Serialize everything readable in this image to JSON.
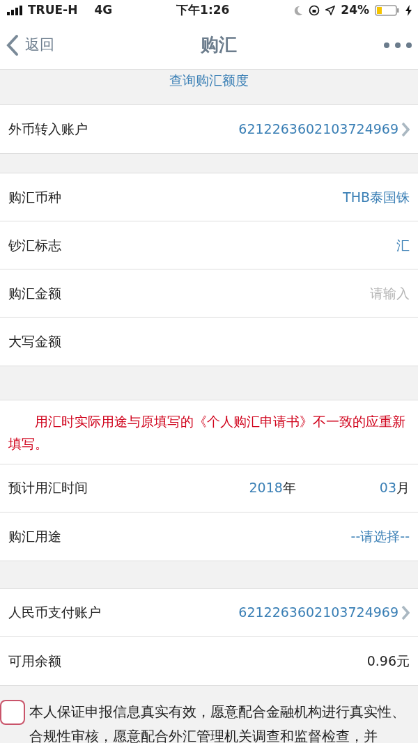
{
  "status_bar": {
    "carrier": "TRUE-H",
    "network": "4G",
    "time": "下午1:26",
    "battery": "24%"
  },
  "nav": {
    "back": "返回",
    "title": "购汇"
  },
  "quota_link": "查询购汇额度",
  "groups": [
    {
      "kind": "rows",
      "rows": [
        {
          "kind": "account",
          "label": "外币转入账户",
          "value": "6212263602103724969"
        }
      ]
    },
    {
      "kind": "rows",
      "rows": [
        {
          "kind": "value",
          "label": "购汇币种",
          "value": "THB泰国铢"
        },
        {
          "kind": "value",
          "label": "钞汇标志",
          "value": "汇"
        },
        {
          "kind": "input",
          "label": "购汇金额",
          "placeholder": "请输入"
        },
        {
          "kind": "plain",
          "label": "大写金额"
        }
      ]
    },
    {
      "kind": "rows",
      "notice": "用汇时实际用途与原填写的《个人购汇申请书》不一致的应重新填写。",
      "rows": [
        {
          "kind": "date",
          "label": "预计用汇时间",
          "year": "2018",
          "year_unit": "年",
          "month": "03",
          "month_unit": "月"
        },
        {
          "kind": "value",
          "label": "购汇用途",
          "value": "--请选择--"
        }
      ]
    },
    {
      "kind": "rows",
      "rows": [
        {
          "kind": "account",
          "label": "人民币支付账户",
          "value": "6212263602103724969"
        },
        {
          "kind": "balance",
          "label": "可用余额",
          "value": "0.96元"
        }
      ]
    }
  ],
  "agreement": {
    "checked": false,
    "text": "本人保证申报信息真实有效，愿意配合金融机构进行真实性、合规性审核，愿意配合外汇管理机关调查和监督检查，并"
  }
}
